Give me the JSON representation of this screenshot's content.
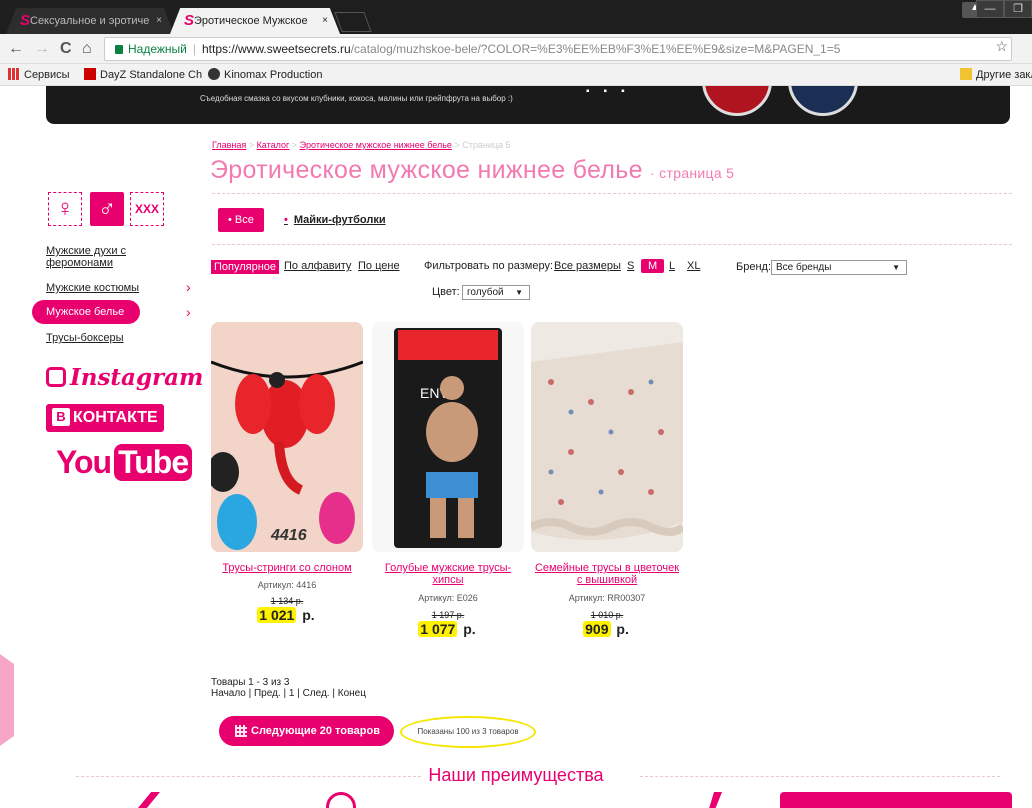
{
  "tabs": [
    {
      "label": "Сексуальное и эротиче",
      "close": "×"
    },
    {
      "label": "Эротическое Мужское",
      "close": "×"
    }
  ],
  "browser": {
    "secure_label": "Надежный",
    "url_host": "https://www.sweetsecrets.ru",
    "url_path": "/catalog/muzhskoe-bele/?COLOR=%E3%EE%EB%F3%E1%EE%E9&size=M&PAGEN_1=5",
    "back": "←",
    "forward": "→",
    "reload": "C",
    "home": "⌂",
    "star": "☆"
  },
  "bookmarks": {
    "apps": "Сервисы",
    "dayz": "DayZ Standalone Ch",
    "kinomax": "Kinomax Production",
    "other": "Другие закл"
  },
  "banner": {
    "text": "Съедобная смазка со вкусом клубники, кокоса, малины или грейпфрута на выбор :)",
    "dots": "▪▪▪"
  },
  "breadcrumb": {
    "home": "Главная",
    "sep": ">",
    "catalog": "Каталог",
    "section": "Эротическое мужское нижнее белье",
    "current": "Страница 5"
  },
  "page_title": "Эротическое мужское нижнее белье",
  "page_subtitle": "· страница 5",
  "sidebar": {
    "female": "♀",
    "male": "♂",
    "xxx": "XXX",
    "links": [
      {
        "label": "Мужские духи с феромонами"
      },
      {
        "label": "Мужские костюмы",
        "arrow": "›"
      },
      {
        "label": "Мужское белье",
        "arrow": "›"
      },
      {
        "label": "Трусы-боксеры"
      }
    ],
    "instagram": "Instagram",
    "vk_b": "B",
    "vk": "КОНТАКТЕ",
    "yt_you": "You",
    "yt_tube": "Tube"
  },
  "categories": {
    "all": "• Все",
    "tshirts": "Майки-футболки"
  },
  "sort": {
    "popular": "Популярное",
    "alpha": "По алфавиту",
    "price": "По цене"
  },
  "filter": {
    "size_label": "Фильтровать по размеру:",
    "all_sizes": "Все размеры",
    "sizes": [
      "S",
      "M",
      "L",
      "XL"
    ],
    "active_size": "M",
    "brand_label": "Бренд:",
    "brand_value": "Все бренды",
    "color_label": "Цвет:",
    "color_value": "голубой",
    "caret": "▼"
  },
  "products": [
    {
      "name": "Трусы-стринги со слоном",
      "article": "Артикул: 4416",
      "old_price": "1 134 р.",
      "price": "1 021",
      "currency": "р.",
      "image_label": "4416"
    },
    {
      "name": "Голубые мужские трусы-хипсы",
      "article": "Артикул: E026",
      "old_price": "1 197 р.",
      "price": "1 077",
      "currency": "р.",
      "image_label": "ENVY"
    },
    {
      "name": "Семейные трусы в цветочек с вышивкой",
      "article": "Артикул: RR00307",
      "old_price": "1 010 р.",
      "price": "909",
      "currency": "р."
    }
  ],
  "pager": {
    "count": "Товары 1 - 3 из 3",
    "nav": "Начало | Пред. | 1 | След. | Конец"
  },
  "next_button": "Следующие 20 товаров",
  "shown_text": "Показаны 100 из 3 товаров",
  "advantages_title": "Наши преимущества",
  "colors": {
    "accent": "#e8006f",
    "title_pink": "#f37ab0",
    "highlight": "#fff200"
  }
}
